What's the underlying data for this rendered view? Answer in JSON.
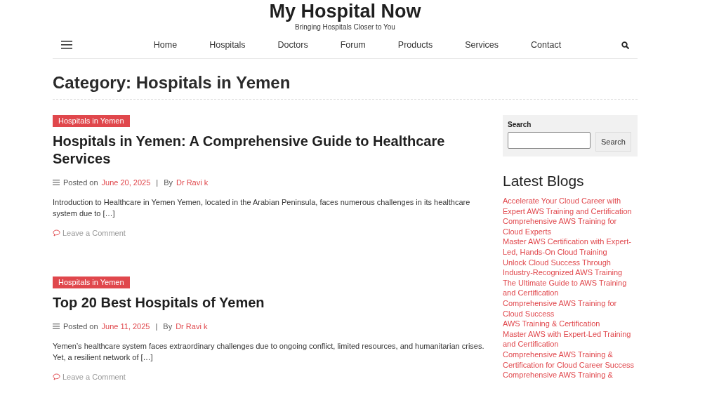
{
  "site": {
    "title": "My Hospital Now",
    "tagline": "Bringing Hospitals Closer to You"
  },
  "nav": {
    "items": [
      {
        "label": "Home"
      },
      {
        "label": "Hospitals"
      },
      {
        "label": "Doctors"
      },
      {
        "label": "Forum"
      },
      {
        "label": "Products"
      },
      {
        "label": "Services"
      },
      {
        "label": "Contact"
      }
    ]
  },
  "page_title": "Category: Hospitals in Yemen",
  "posts": [
    {
      "category": "Hospitals in Yemen",
      "title": "Hospitals in Yemen: A Comprehensive Guide to Healthcare Services",
      "posted_label": "Posted on",
      "date": "June 20, 2025",
      "separator": "|",
      "by_label": "By",
      "author": "Dr Ravi k",
      "excerpt": "Introduction to Healthcare in Yemen Yemen, located in the Arabian Peninsula, faces numerous challenges in its healthcare system due to […]",
      "comment_link": "Leave a Comment"
    },
    {
      "category": "Hospitals in Yemen",
      "title": "Top 20 Best Hospitals of Yemen",
      "posted_label": "Posted on",
      "date": "June 11, 2025",
      "separator": "|",
      "by_label": "By",
      "author": "Dr Ravi k",
      "excerpt": "Yemen’s healthcare system faces extraordinary challenges due to ongoing conflict, limited resources, and humanitarian crises. Yet, a resilient network of […]",
      "comment_link": "Leave a Comment"
    }
  ],
  "sidebar": {
    "search": {
      "label": "Search",
      "button": "Search"
    },
    "latest_blogs": {
      "title": "Latest Blogs",
      "items": [
        "Accelerate Your Cloud Career with Expert AWS Training and Certification",
        "Comprehensive AWS Training for Cloud Experts",
        "Master AWS Certification with Expert-Led, Hands-On Cloud Training",
        "Unlock Cloud Success Through Industry-Recognized AWS Training",
        "The Ultimate Guide to AWS Training and Certification",
        "Comprehensive AWS Training for Cloud Success",
        "AWS Training & Certification",
        "Master AWS with Expert-Led Training and Certification",
        "Comprehensive AWS Training & Certification for Cloud Career Success",
        "Comprehensive AWS Training &"
      ]
    }
  }
}
